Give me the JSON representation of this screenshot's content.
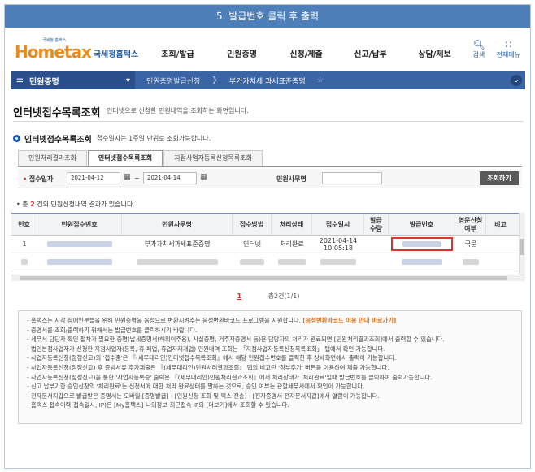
{
  "step_banner": "5. 발급번호 클릭 후 출력",
  "logo": {
    "small": "국세청 홈택스",
    "home": "Home",
    "tax": "tax",
    "brand": "국세청홈택스"
  },
  "menu": [
    "조회/발급",
    "민원증명",
    "신청/제출",
    "신고/납부",
    "상담/제보"
  ],
  "top_icons": [
    {
      "label": "검색",
      "icon": "search-icon"
    },
    {
      "label": "전체메뉴",
      "icon": "grid-menu-icon"
    }
  ],
  "nav": {
    "menu": "민원증명",
    "crumbs": [
      "민원증명발급신청",
      "부가가치세 과세표준증명"
    ]
  },
  "page": {
    "title": "인터넷접수목록조회",
    "desc": "인터넷으로 신청한 민원내역을 조회하는 화면입니다."
  },
  "section": {
    "title": "인터넷접수목록조회",
    "note": "접수일자는 1주일 단위로 조회가능합니다."
  },
  "tabs": [
    "민원처리결과조회",
    "인터넷접수목록조회",
    "지점사업자등록신청목록조회"
  ],
  "search": {
    "date_label": "접수일자",
    "from": "2021-04-12",
    "to": "2021-04-14",
    "tilde": "~",
    "office_label": "민원사무명",
    "office_value": "",
    "button": "조회하기"
  },
  "count": {
    "prefix": "• 총 ",
    "n": "2",
    "suffix": " 건의 민원신청내역 결과가 있습니다."
  },
  "table": {
    "headers": [
      "번호",
      "민원접수번호",
      "민원사무명",
      "접수방법",
      "처리상태",
      "접수일시",
      "발급\n수량",
      "발급번호",
      "영문신청\n여부",
      "비고"
    ],
    "rows": [
      {
        "no": "1",
        "office": "부가가치세과세표준증명",
        "method": "인터넷",
        "status": "처리완료",
        "date": "2021-04-14",
        "time": "10:05:18",
        "qty": "",
        "eng": "국문",
        "note": ""
      },
      {
        "no": "2",
        "office": "",
        "method": "",
        "status": "",
        "date": "",
        "time": "",
        "qty": "",
        "eng": "",
        "note": ""
      }
    ]
  },
  "pager": {
    "page": "1",
    "total": "총2건(1/1)"
  },
  "notes": [
    "- 홈택스는 시각 장애인분들을 위해 민원증명을 음성으로 변환시켜주는 음성변환바코드 프로그램을 지원합니다.",
    "[음성변환바코드 이용 안내 바로가기]",
    "- 증명서를 조회/출력하기 위해서는 발급번호를 클릭하시기 바랍니다.",
    "- 세무서 담당자 확인 절차가 필요한 증명(납세증명서(해외이주용), 사실증명, 거주자증명서 등)은 담당자의 처리가 완료되면 [민원처리결과조회]에서 출력할 수 있습니다.",
    "- 법인본점사업자가 신청한 지점사업자(등록, 휴·폐업, 휴업자재개업) 민원내역 조회는 「지점사업자등록신청목록조회」 탭에서 확인 가능합니다.",
    "- 사업자등록신청(정정신고)의 '접수중'은 『(세무대리인)인터넷접수목록조회』에서 해당 민원접수번호를 클릭한 후 상세화면에서 출력이 가능합니다.",
    "- 사업자등록신청(정정신고) 후 증빙서류 추가제출은 『(세무대리인)민원처리결과조회』 탭의 비고란 '첨부추가' 버튼을 이용하여 제출 가능합니다.",
    "- 사업자등록신청(정정신고)을 통한 '사업자등록증' 출력은 『(세무대리인)민원처리결과조회』에서 처리상태가 '처리완료'일때 발급번호를 클릭하여 출력가능합니다.",
    "- 신고 납부기한 승인신청의 '처리완료'는 신청서에 대한 처리 완료상태를 말하는 것으로, 승인 여부는 관할세무서에서 확인이 가능합니다.",
    "- 전자문서지갑으로 발급받은 증명서는 모바일 [증명발급] - [민원신청 조회 및 팩스 전송] - [전자증명서 전자문서지갑]에서 열람이 가능합니다.",
    "- 홈택스 접속이력(접속일시, IP)은 [My홈택스]-나의정보-최근접속 IP의 [더보기]에서 조회할 수 있습니다."
  ],
  "colors": {
    "banner": "#4f7fb9",
    "nav": "#3b64a5",
    "accent_red": "#d0312d",
    "brand_blue": "#1d58a8"
  }
}
